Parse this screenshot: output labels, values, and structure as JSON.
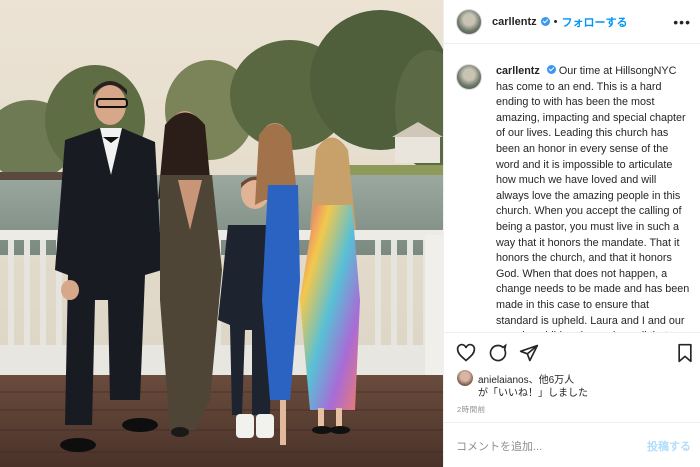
{
  "header": {
    "username": "carllentz",
    "separator": "•",
    "follow_label": "フォローする",
    "more_label": "•••"
  },
  "caption": {
    "username": "carllentz",
    "text": "Our time at HillsongNYC has come to an end. This is a hard ending to with has been the most amazing, impacting and special chapter of our lives. Leading this church has been an honor in every sense of the word and it is impossible to articulate how much we have loved and will always love the amazing people in this church. When you accept the calling of being a pastor, you must live in such a way that it honors the mandate. That it honors the church, and that it honors God. When that does not happen, a change needs to be made and has been made in this case to ensure that standard is upheld. Laura and I and our amazing children have given all that we have to serve and build this church and"
  },
  "actions": {
    "like_icon": "heart-icon",
    "comment_icon": "comment-icon",
    "share_icon": "send-icon",
    "save_icon": "bookmark-icon"
  },
  "likes": {
    "line1": "anielaianos、他6万人",
    "line2": "が「いいね！」しました"
  },
  "timestamp": "2時間前",
  "comment_box": {
    "placeholder": "コメントを追加...",
    "post_label": "投稿する"
  },
  "colors": {
    "accent": "#0095f6",
    "verified": "#3897f0",
    "post_disabled": "#b2dffc"
  }
}
